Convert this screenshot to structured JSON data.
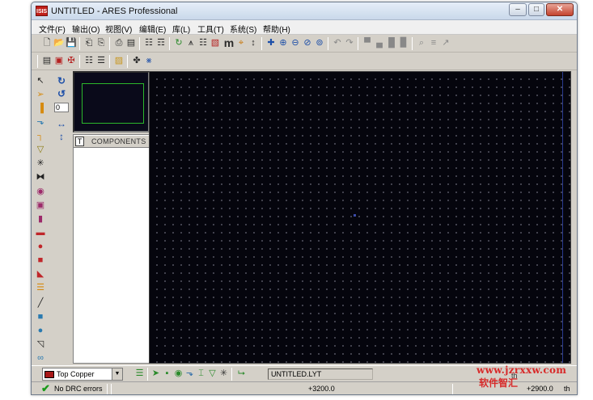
{
  "window": {
    "app_icon_text": "ISIS",
    "title": "UNTITLED - ARES Professional",
    "minimize_icon": "minimize-icon",
    "maximize_icon": "maximize-icon",
    "close_icon": "close-icon"
  },
  "menu": {
    "items": [
      "文件(F)",
      "输出(O)",
      "视图(V)",
      "编辑(E)",
      "库(L)",
      "工具(T)",
      "系统(S)",
      "帮助(H)"
    ]
  },
  "toolbar": {
    "icons_row1": [
      "new-file-icon",
      "open-folder-icon",
      "save-icon",
      "import-icon",
      "export-icon",
      "print-icon",
      "print-preview-icon",
      "netlist-icon",
      "netlist-compile-icon",
      "refresh-icon",
      "connectivity-icon",
      "grid-icon",
      "layers-icon",
      "metric-icon",
      "origin-icon",
      "cursor-icon",
      "pan-icon",
      "zoom-in-icon",
      "zoom-out-icon",
      "zoom-all-icon",
      "zoom-area-icon",
      "undo-icon",
      "redo-icon",
      "block-copy-icon",
      "block-move-icon",
      "block-rotate-icon",
      "block-delete-icon",
      "search-icon",
      "autoroute-icon",
      "design-rules-icon"
    ],
    "metric_label": "m",
    "icons_row2": [
      "layer-view-icon",
      "board-edge-icon",
      "drc-icon",
      "bill-of-materials-icon",
      "netlist-view-icon",
      "power-plane-icon",
      "tidy-icon",
      "cad-export-icon"
    ]
  },
  "left_tools": [
    "select-icon",
    "component-icon",
    "package-icon",
    "track-icon",
    "via-icon",
    "zone-icon",
    "ratsnest-icon",
    "connection-icon",
    "round-pad-icon",
    "square-pad-icon",
    "dil-pad-icon",
    "edge-pad-icon",
    "circle-pad-icon",
    "rect-pad-icon",
    "polygon-pad-icon",
    "padstack-icon",
    "line-icon",
    "box-icon",
    "circle-icon",
    "arc-icon",
    "path-icon"
  ],
  "rotation": {
    "rotate_cw_icon": "rotate-clockwise-icon",
    "rotate_ccw_icon": "rotate-counterclockwise-icon",
    "angle_value": "0",
    "mirror_x_icon": "mirror-horizontal-icon",
    "mirror_y_icon": "mirror-vertical-icon"
  },
  "components_panel": {
    "toggle_label": "T",
    "title": "COMPONENTS"
  },
  "bottom": {
    "layer": {
      "name": "Top Copper",
      "color": "#a81818"
    },
    "layer_tools": [
      "layer-stack-icon",
      "place-icon",
      "pad-icon",
      "route-icon",
      "via-place-icon",
      "test-icon",
      "zone-tool-icon",
      "ratsnest-tool-icon",
      "trace-icon"
    ],
    "file_name": "UNTITLED.LYT"
  },
  "status": {
    "drc_text": "No DRC errors",
    "coord_x": "+3200.0",
    "coord_y": "+2900.0",
    "unit": "th",
    "unit_top": "th"
  },
  "watermark": {
    "url": "www.jzrxxw.com",
    "cn_text": "软件智汇"
  },
  "colors": {
    "canvas_bg": "#05050d",
    "grid_dot": "#7a7a8a",
    "overview_frame": "#2bb82b",
    "drc_ok": "#1a9a1a",
    "watermark": "#d82a2a"
  }
}
